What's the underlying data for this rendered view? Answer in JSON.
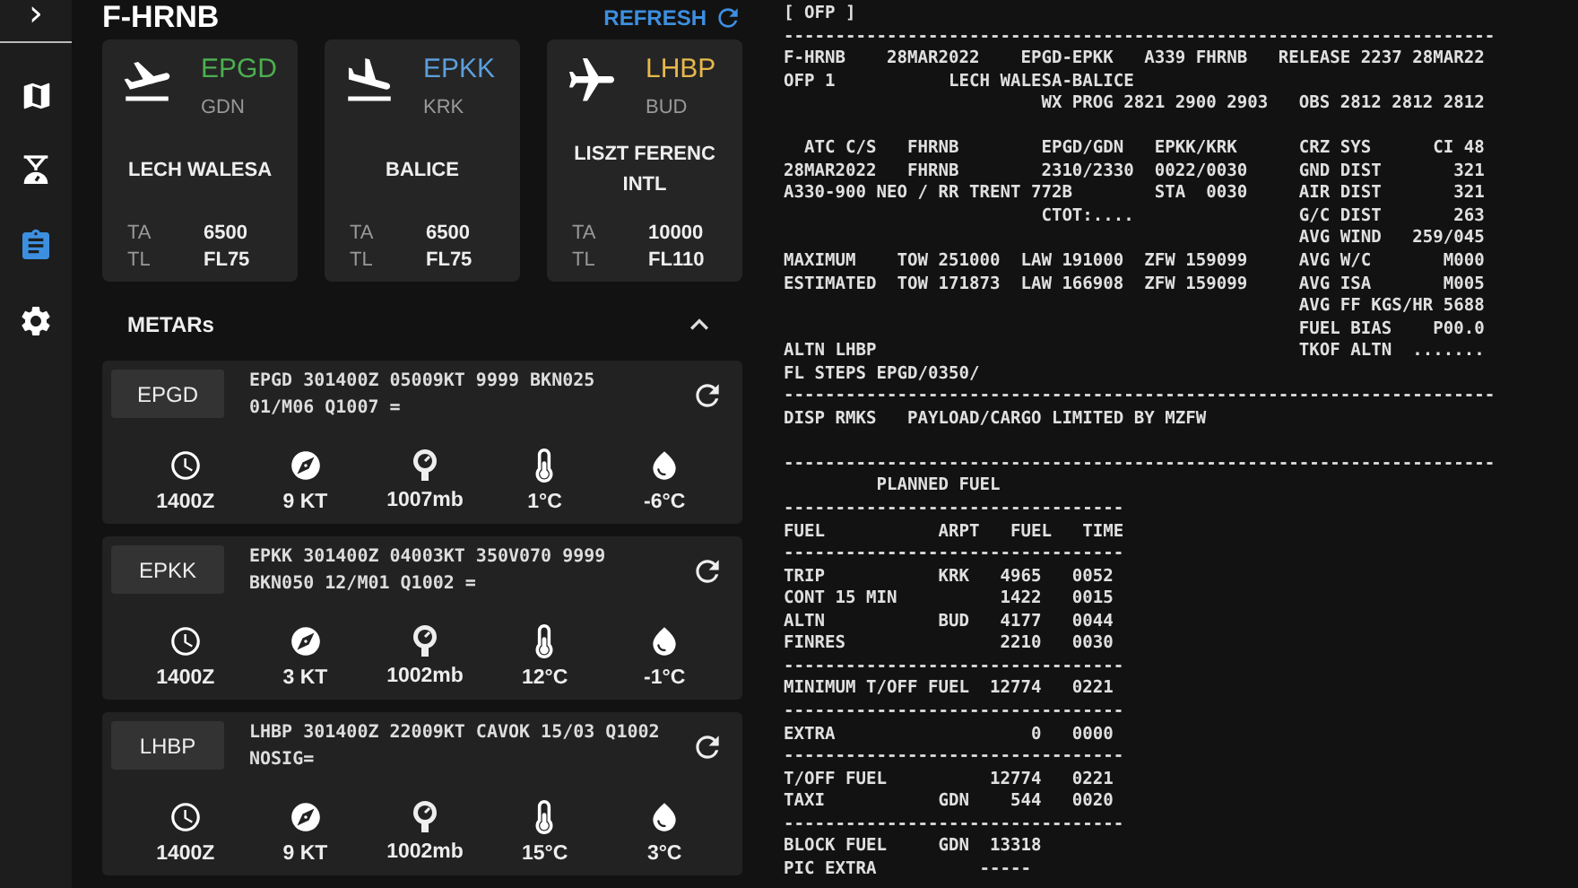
{
  "sidebar": {
    "toggle": "›",
    "items": [
      {
        "kind": "map",
        "selected": false
      },
      {
        "kind": "scale",
        "selected": false
      },
      {
        "kind": "clipboard",
        "selected": true
      },
      {
        "kind": "settings",
        "selected": false
      }
    ]
  },
  "header": {
    "title": "F-HRNB",
    "refresh": "REFRESH"
  },
  "airports": [
    {
      "kind": "departure",
      "icao": "EPGD",
      "color": "#4caf50",
      "iata": "GDN",
      "name": "LECH WALESA",
      "ta_label": "TA",
      "ta": "6500",
      "tl_label": "TL",
      "tl": "FL75"
    },
    {
      "kind": "arrival",
      "icao": "EPKK",
      "color": "#5c9fdc",
      "iata": "KRK",
      "name": "BALICE",
      "ta_label": "TA",
      "ta": "6500",
      "tl_label": "TL",
      "tl": "FL75"
    },
    {
      "kind": "alternate",
      "icao": "LHBP",
      "color": "#e6b84c",
      "iata": "BUD",
      "name": "LISZT FERENC INTL",
      "ta_label": "TA",
      "ta": "10000",
      "tl_label": "TL",
      "tl": "FL110"
    }
  ],
  "metars": {
    "title": "METARs",
    "expanded": true,
    "items": [
      {
        "icao": "EPGD",
        "raw": "EPGD 301400Z 05009KT 9999 BKN025 01/M06 Q1007 =",
        "time": "1400Z",
        "wind": "9 KT",
        "pressure": "1007mb",
        "temperature": "1°C",
        "dewpoint": "-6°C"
      },
      {
        "icao": "EPKK",
        "raw": "EPKK 301400Z 04003KT 350V070 9999 BKN050 12/M01 Q1002 =",
        "time": "1400Z",
        "wind": "3 KT",
        "pressure": "1002mb",
        "temperature": "12°C",
        "dewpoint": "-1°C"
      },
      {
        "icao": "LHBP",
        "raw": "LHBP 301400Z 22009KT CAVOK 15/03 Q1002 NOSIG=",
        "time": "1400Z",
        "wind": "9 KT",
        "pressure": "1002mb",
        "temperature": "15°C",
        "dewpoint": "3°C"
      }
    ]
  },
  "ofp": {
    "blocks": [
      [
        "[ OFP ]",
        "---------------------------------------------------------------------",
        "F-HRNB    28MAR2022    EPGD-EPKK   A339 FHRNB   RELEASE 2237 28MAR22",
        "OFP 1           LECH WALESA-BALICE",
        "                         WX PROG 2821 2900 2903   OBS 2812 2812 2812"
      ],
      [
        "  ATC C/S   FHRNB        EPGD/GDN   EPKK/KRK      CRZ SYS      CI 48",
        "28MAR2022   FHRNB        2310/2330  0022/0030     GND DIST       321",
        "A330-900 NEO / RR TRENT 772B        STA  0030     AIR DIST       321",
        "                         CTOT:....                G/C DIST       263",
        "                                                  AVG WIND   259/045",
        "MAXIMUM    TOW 251000  LAW 191000  ZFW 159099     AVG W/C       M000",
        "ESTIMATED  TOW 171873  LAW 166908  ZFW 159099     AVG ISA       M005",
        "                                                  AVG FF KGS/HR 5688",
        "                                                  FUEL BIAS    P00.0",
        "ALTN LHBP                                         TKOF ALTN  .......",
        "FL STEPS EPGD/0350/",
        "---------------------------------------------------------------------",
        "DISP RMKS   PAYLOAD/CARGO LIMITED BY MZFW"
      ],
      [
        "---------------------------------------------------------------------",
        "         PLANNED FUEL",
        "---------------------------------",
        "FUEL           ARPT   FUEL   TIME",
        "---------------------------------",
        "TRIP           KRK   4965   0052",
        "CONT 15 MIN          1422   0015",
        "ALTN           BUD   4177   0044",
        "FINRES               2210   0030",
        "---------------------------------",
        "MINIMUM T/OFF FUEL  12774   0221",
        "---------------------------------",
        "EXTRA                   0   0000",
        "---------------------------------",
        "T/OFF FUEL          12774   0221",
        "TAXI           GDN    544   0020",
        "---------------------------------",
        "BLOCK FUEL     GDN  13318",
        "PIC EXTRA          -----"
      ]
    ]
  }
}
